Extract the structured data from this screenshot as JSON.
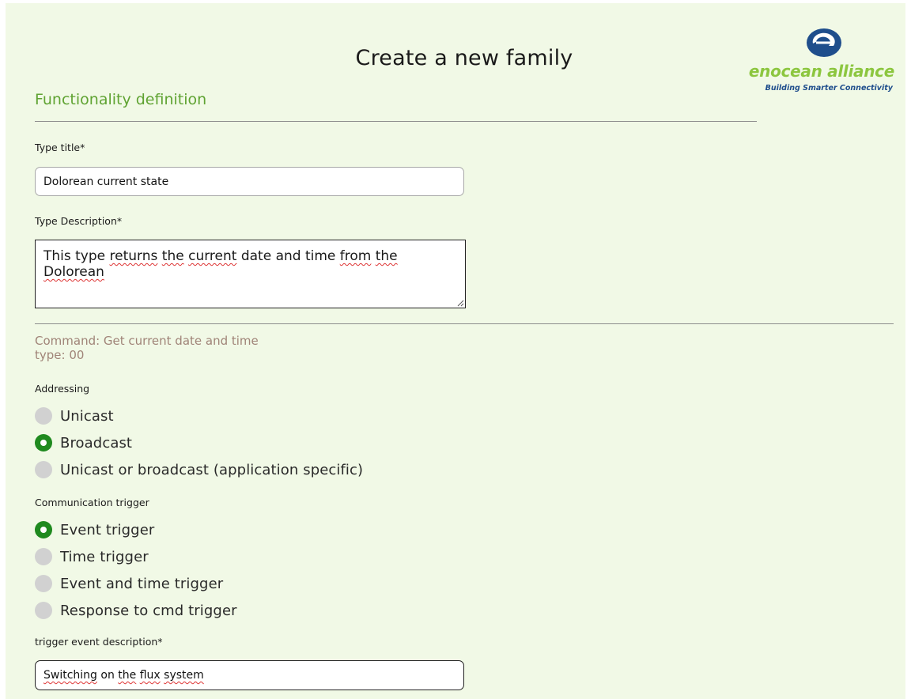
{
  "page": {
    "title": "Create a new family",
    "section_title": "Functionality definition"
  },
  "logo": {
    "brand": "enocean alliance",
    "tagline": "Building Smarter Connectivity",
    "colors": {
      "brand": "#8cc63f",
      "icon": "#1f4e8c"
    }
  },
  "form": {
    "type_title": {
      "label": "Type title*",
      "value": "Dolorean current state"
    },
    "type_description": {
      "label": "Type Description*",
      "value_parts": [
        "This type ",
        "returns",
        " ",
        "the",
        " ",
        "current",
        " date and time ",
        "from",
        " ",
        "the",
        " ",
        "Dolorean"
      ]
    },
    "command": {
      "line1": "Command: Get current date and time",
      "line2": "type: 00"
    },
    "addressing": {
      "label": "Addressing",
      "options": [
        "Unicast",
        "Broadcast",
        "Unicast or broadcast (application specific)"
      ],
      "selected": "Broadcast"
    },
    "communication_trigger": {
      "label": "Communication trigger",
      "options": [
        "Event trigger",
        "Time trigger",
        "Event and time trigger",
        "Response to cmd trigger"
      ],
      "selected": "Event trigger"
    },
    "trigger_event_description": {
      "label": "trigger event description*",
      "value_parts": [
        "Switching",
        " on ",
        "the",
        " ",
        "flux",
        " ",
        "system"
      ]
    }
  },
  "colors": {
    "background": "#f1f9e6",
    "section_title": "#5fa332",
    "command_text": "#a08478",
    "radio_selected": "#1f8a1f",
    "radio_unselected": "#d1d1d1"
  }
}
